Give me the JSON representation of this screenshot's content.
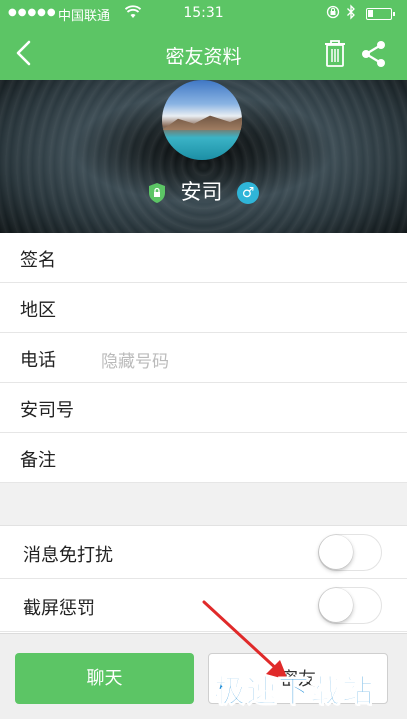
{
  "status_bar": {
    "signal": "●●●●●",
    "carrier": "中国联通",
    "time": "15:31"
  },
  "nav": {
    "title": "密友资料"
  },
  "profile": {
    "name": "安司",
    "gender": "♂"
  },
  "info_rows": [
    {
      "label": "签名",
      "value": ""
    },
    {
      "label": "地区",
      "value": ""
    },
    {
      "label": "电话",
      "value": "隐藏号码"
    },
    {
      "label": "安司号",
      "value": ""
    },
    {
      "label": "备注",
      "value": ""
    }
  ],
  "toggles": [
    {
      "label": "消息免打扰",
      "on": false
    },
    {
      "label": "截屏惩罚",
      "on": false
    }
  ],
  "actions": {
    "chat_label": "聊天",
    "call_label": "密友"
  },
  "watermark": "极速下载站",
  "colors": {
    "brand_green": "#5cc565",
    "gender_blue": "#2fb5d8",
    "annotation_red": "#e02a2a",
    "watermark_blue": "#1f8ed8"
  },
  "icons": {
    "back": "chevron-left",
    "trash": "trash",
    "share": "share",
    "shield": "shield-lock",
    "gender": "male-symbol"
  }
}
